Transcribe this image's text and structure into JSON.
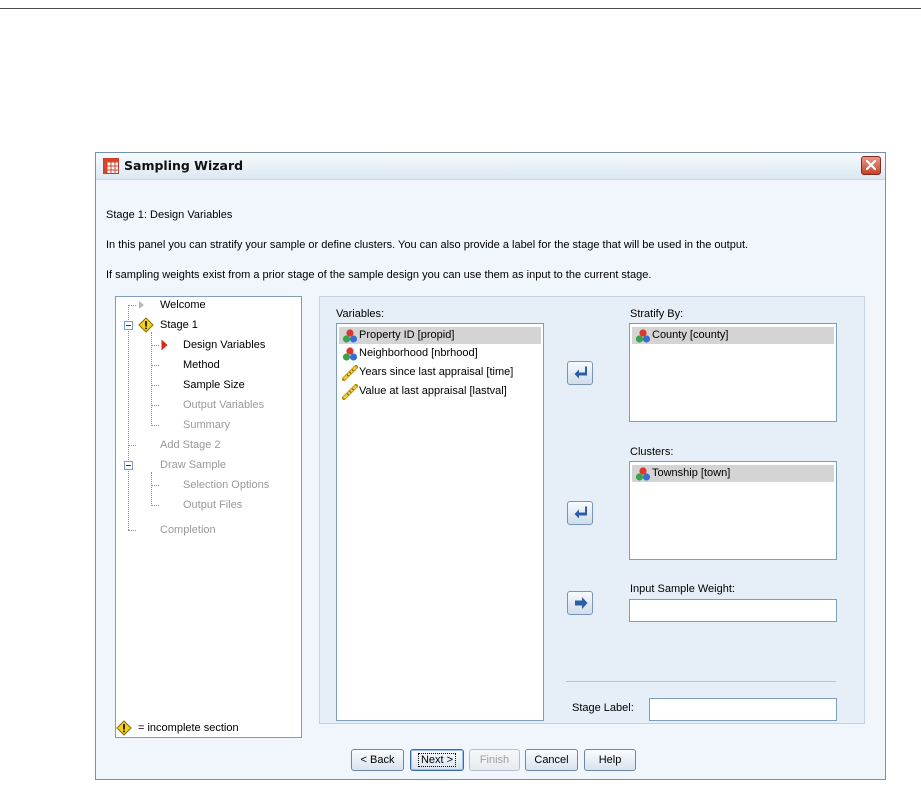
{
  "window": {
    "title": "Sampling Wizard"
  },
  "header": {
    "stage_title": "Stage 1: Design Variables",
    "description_1": "In this panel you can stratify your sample or define clusters. You can also provide a label for the stage that will be used in the output.",
    "description_2": "If sampling weights exist from a prior stage of the sample design you can use them as input to the current stage."
  },
  "tree": {
    "items": [
      {
        "label": "Welcome",
        "state": "done"
      },
      {
        "label": "Stage 1",
        "state": "incomplete"
      },
      {
        "label": "Design Variables",
        "state": "current"
      },
      {
        "label": "Method",
        "state": "active"
      },
      {
        "label": "Sample Size",
        "state": "active"
      },
      {
        "label": "Output Variables",
        "state": "disabled"
      },
      {
        "label": "Summary",
        "state": "disabled"
      },
      {
        "label": "Add Stage 2",
        "state": "disabled"
      },
      {
        "label": "Draw Sample",
        "state": "disabled"
      },
      {
        "label": "Selection Options",
        "state": "disabled"
      },
      {
        "label": "Output Files",
        "state": "disabled"
      },
      {
        "label": "Completion",
        "state": "disabled"
      }
    ],
    "legend": "= incomplete section"
  },
  "variables": {
    "label": "Variables:",
    "items": [
      {
        "label": "Property ID [propid]",
        "icon": "nominal-icon",
        "selected": true
      },
      {
        "label": "Neighborhood [nbrhood]",
        "icon": "nominal-icon",
        "selected": false
      },
      {
        "label": "Years since last appraisal [time]",
        "icon": "scale-icon",
        "selected": false
      },
      {
        "label": "Value at last appraisal [lastval]",
        "icon": "scale-icon",
        "selected": false
      }
    ]
  },
  "stratify": {
    "label": "Stratify By:",
    "items": [
      {
        "label": "County [county]",
        "icon": "nominal-icon"
      }
    ]
  },
  "clusters": {
    "label": "Clusters:",
    "items": [
      {
        "label": "Township [town]",
        "icon": "nominal-icon"
      }
    ]
  },
  "weight": {
    "label": "Input Sample Weight:",
    "value": ""
  },
  "stage_label": {
    "label": "Stage Label:",
    "value": ""
  },
  "buttons": {
    "back": "< Back",
    "next": "Next >",
    "finish": "Finish",
    "cancel": "Cancel",
    "help": "Help"
  },
  "colors": {
    "accent": "#d8281c",
    "warning": "#f2d21b",
    "selection": "#d4d4d4"
  }
}
